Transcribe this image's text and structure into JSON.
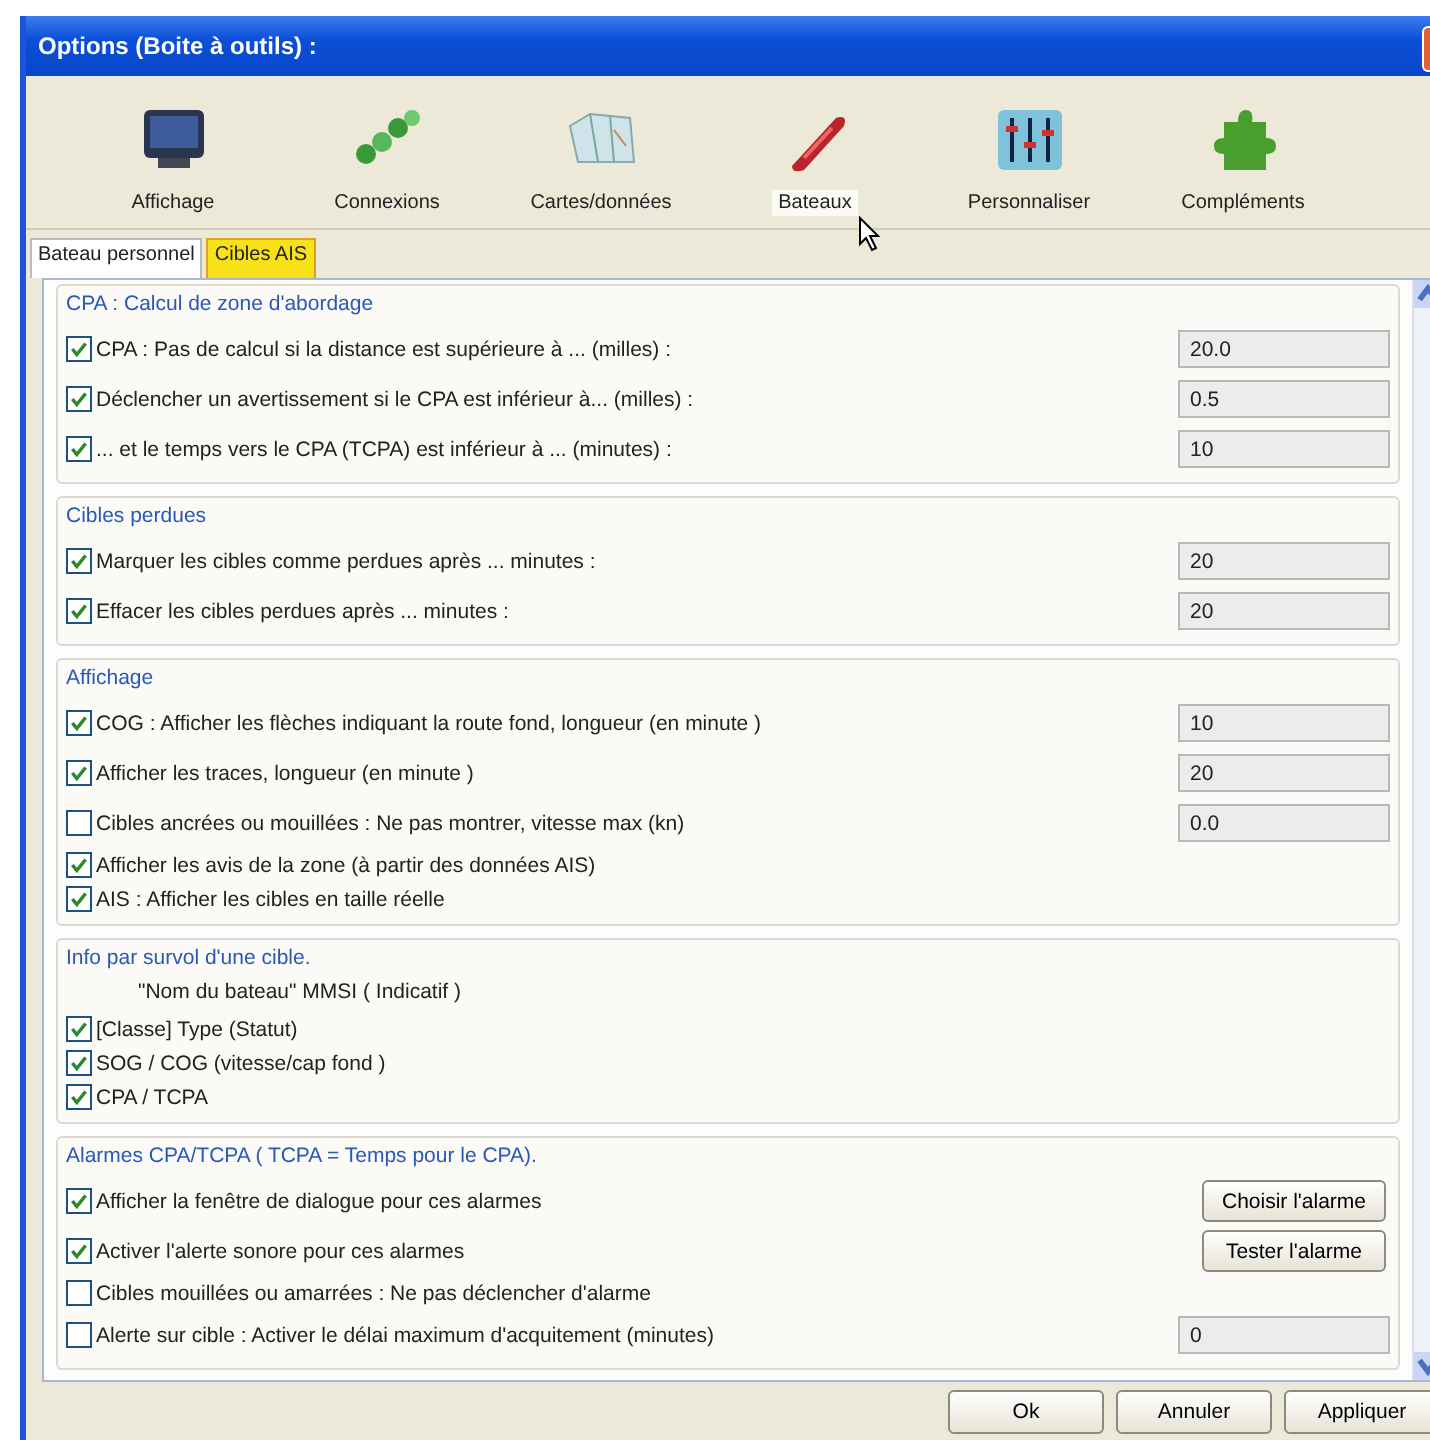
{
  "window": {
    "title": "Options (Boite à outils) :"
  },
  "toolbar": [
    {
      "label": "Affichage",
      "kind": "monitor",
      "selected": false
    },
    {
      "label": "Connexions",
      "kind": "chain",
      "selected": false
    },
    {
      "label": "Cartes/données",
      "kind": "charts",
      "selected": false
    },
    {
      "label": "Bateaux",
      "kind": "boat",
      "selected": true
    },
    {
      "label": "Personnaliser",
      "kind": "sliders",
      "selected": false
    },
    {
      "label": "Compléments",
      "kind": "puzzle",
      "selected": false
    }
  ],
  "tabs": [
    {
      "label": "Bateau personnel",
      "selected": false
    },
    {
      "label": "Cibles AIS",
      "selected": true
    }
  ],
  "groups": [
    {
      "title": "CPA : Calcul de zone d'abordage",
      "rows": [
        {
          "kind": "check",
          "label": "CPA : Pas de calcul si la distance est supérieure à ... (milles) :",
          "checked": true,
          "value": "20.0"
        },
        {
          "kind": "check",
          "label": "Déclencher un avertissement si le CPA est inférieur à... (milles) :",
          "checked": true,
          "value": "0.5"
        },
        {
          "kind": "check",
          "label": "... et le temps vers le CPA (TCPA) est inférieur à ... (minutes) :",
          "checked": true,
          "value": "10"
        }
      ]
    },
    {
      "title": "Cibles perdues",
      "rows": [
        {
          "kind": "check",
          "label": "Marquer les cibles comme perdues après ... minutes :",
          "checked": true,
          "value": "20"
        },
        {
          "kind": "check",
          "label": "Effacer les cibles perdues après ... minutes :",
          "checked": true,
          "value": "20"
        }
      ]
    },
    {
      "title": "Affichage",
      "rows": [
        {
          "kind": "check",
          "label": "COG : Afficher les flèches indiquant la route fond, longueur (en minute )",
          "checked": true,
          "value": "10"
        },
        {
          "kind": "check",
          "label": "Afficher les traces, longueur (en minute )",
          "checked": true,
          "value": "20"
        },
        {
          "kind": "check",
          "label": "Cibles ancrées ou mouillées : Ne pas montrer, vitesse max (kn)",
          "checked": false,
          "value": "0.0"
        },
        {
          "kind": "check",
          "label": "Afficher les avis de la zone (à partir des données AIS)",
          "checked": true
        },
        {
          "kind": "check",
          "label": "AIS : Afficher les cibles en taille réelle",
          "checked": true
        }
      ]
    },
    {
      "title": "Info par survol d'une cible.",
      "rows": [
        {
          "kind": "note",
          "label": "\"Nom du bateau\"  MMSI  ( Indicatif )"
        },
        {
          "kind": "check",
          "label": "[Classe] Type (Statut)",
          "checked": true
        },
        {
          "kind": "check",
          "label": "SOG / COG  (vitesse/cap fond )",
          "checked": true
        },
        {
          "kind": "check",
          "label": "CPA / TCPA",
          "checked": true
        }
      ]
    },
    {
      "title": "Alarmes CPA/TCPA ( TCPA = Temps pour le CPA).",
      "rows": [
        {
          "kind": "check",
          "label": "Afficher la fenêtre de dialogue pour ces alarmes",
          "checked": true,
          "button": "Choisir l'alarme"
        },
        {
          "kind": "check",
          "label": "Activer l'alerte sonore pour ces alarmes",
          "checked": true,
          "button": "Tester l'alarme"
        },
        {
          "kind": "check",
          "label": "Cibles mouillées ou amarrées : Ne pas déclencher d'alarme",
          "checked": false
        },
        {
          "kind": "check",
          "label": "Alerte sur cible : Activer le délai maximum d'acquitement (minutes)",
          "checked": false,
          "value": "0"
        }
      ]
    }
  ],
  "buttons": [
    "Ok",
    "Annuler",
    "Appliquer"
  ]
}
